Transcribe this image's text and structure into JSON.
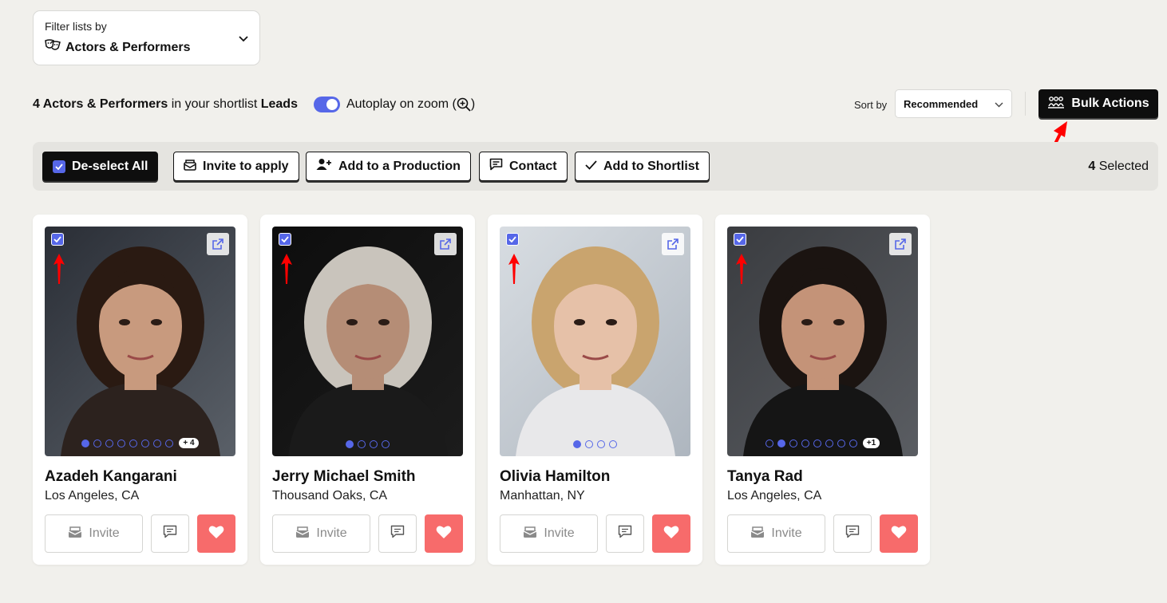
{
  "filter": {
    "label": "Filter lists by",
    "value": "Actors & Performers",
    "icon": "theater-masks-icon"
  },
  "info": {
    "count": "4 Actors & Performers",
    "middle": " in your shortlist ",
    "list_name": "Leads",
    "autoplay_label": "Autoplay on zoom (",
    "autoplay_suffix": ")",
    "autoplay_on": true
  },
  "sort": {
    "label": "Sort by",
    "value": "Recommended"
  },
  "bulk_actions": {
    "label": "Bulk Actions"
  },
  "action_bar": {
    "deselect_label": "De-select All",
    "invite_label": "Invite to apply",
    "add_production_label": "Add to a Production",
    "contact_label": "Contact",
    "add_shortlist_label": "Add to Shortlist",
    "selected_count": "4",
    "selected_label": " Selected"
  },
  "colors": {
    "accent": "#5667e8",
    "favorite": "#f76b6b",
    "annotation": "#ff0000",
    "background": "#f1f0ec"
  },
  "cards": [
    {
      "name": "Azadeh Kangarani",
      "location": "Los Angeles, CA",
      "invite_label": "Invite",
      "selected": true,
      "photo_count_visible": 8,
      "active_photo": 1,
      "more_photos": "+ 4"
    },
    {
      "name": "Jerry Michael Smith",
      "location": "Thousand Oaks, CA",
      "invite_label": "Invite",
      "selected": true,
      "photo_count_visible": 4,
      "active_photo": 1,
      "more_photos": ""
    },
    {
      "name": "Olivia Hamilton",
      "location": "Manhattan, NY",
      "invite_label": "Invite",
      "selected": true,
      "photo_count_visible": 4,
      "active_photo": 1,
      "more_photos": ""
    },
    {
      "name": "Tanya Rad",
      "location": "Los Angeles, CA",
      "invite_label": "Invite",
      "selected": true,
      "photo_count_visible": 8,
      "active_photo": 2,
      "more_photos": "+1"
    }
  ]
}
